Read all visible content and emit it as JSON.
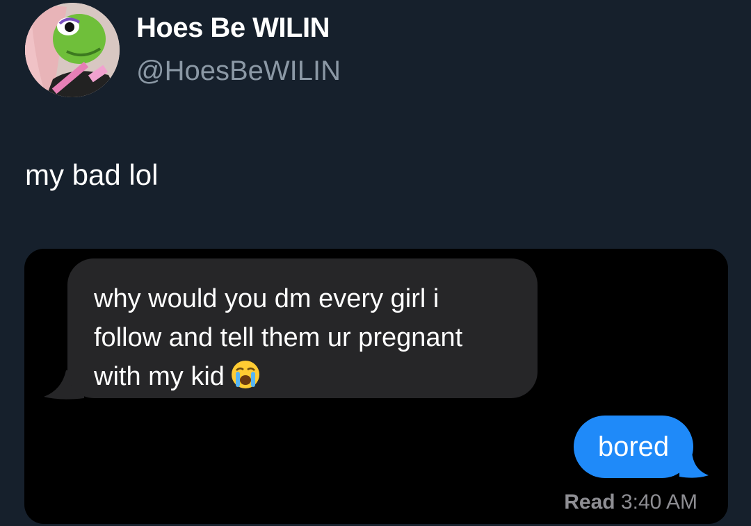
{
  "tweet": {
    "display_name": "Hoes Be WILIN",
    "handle": "@HoesBeWILIN",
    "text": "my bad lol"
  },
  "screenshot": {
    "received_message_lines": [
      "why would you dm every girl i",
      "follow and tell them ur pregnant",
      "with my kid"
    ],
    "received_emoji": "loudly-crying-face-icon",
    "sent_message": "bored",
    "read_label": "Read",
    "read_time": "3:40 AM"
  },
  "colors": {
    "page_background": "#16202c",
    "received_bubble": "#262628",
    "sent_bubble": "#1f8af9",
    "handle_text": "#8b98a5"
  }
}
